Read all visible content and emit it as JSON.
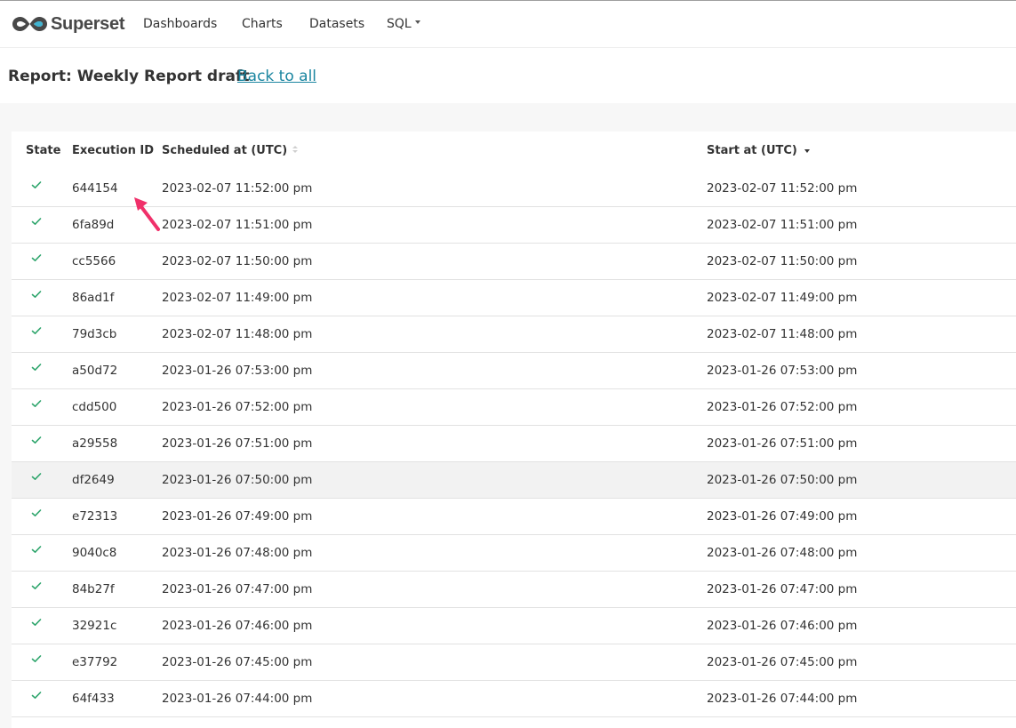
{
  "app": {
    "brand": "Superset",
    "nav": {
      "dashboards": "Dashboards",
      "charts": "Charts",
      "datasets": "Datasets",
      "sql": "SQL"
    }
  },
  "header": {
    "title": "Report: Weekly Report draft",
    "back_link": "Back to all"
  },
  "table": {
    "columns": {
      "state": "State",
      "execution_id": "Execution ID",
      "scheduled_at": "Scheduled at (UTC)",
      "start_at": "Start at (UTC)"
    },
    "sort": {
      "column": "start_at",
      "direction": "descending"
    },
    "status_color": "#2ea56c",
    "rows": [
      {
        "state": "success",
        "execution_id": "644154",
        "scheduled_at": "2023-02-07 11:52:00 pm",
        "start_at": "2023-02-07 11:52:00 pm"
      },
      {
        "state": "success",
        "execution_id": "6fa89d",
        "scheduled_at": "2023-02-07 11:51:00 pm",
        "start_at": "2023-02-07 11:51:00 pm"
      },
      {
        "state": "success",
        "execution_id": "cc5566",
        "scheduled_at": "2023-02-07 11:50:00 pm",
        "start_at": "2023-02-07 11:50:00 pm"
      },
      {
        "state": "success",
        "execution_id": "86ad1f",
        "scheduled_at": "2023-02-07 11:49:00 pm",
        "start_at": "2023-02-07 11:49:00 pm"
      },
      {
        "state": "success",
        "execution_id": "79d3cb",
        "scheduled_at": "2023-02-07 11:48:00 pm",
        "start_at": "2023-02-07 11:48:00 pm"
      },
      {
        "state": "success",
        "execution_id": "a50d72",
        "scheduled_at": "2023-01-26 07:53:00 pm",
        "start_at": "2023-01-26 07:53:00 pm"
      },
      {
        "state": "success",
        "execution_id": "cdd500",
        "scheduled_at": "2023-01-26 07:52:00 pm",
        "start_at": "2023-01-26 07:52:00 pm"
      },
      {
        "state": "success",
        "execution_id": "a29558",
        "scheduled_at": "2023-01-26 07:51:00 pm",
        "start_at": "2023-01-26 07:51:00 pm"
      },
      {
        "state": "success",
        "execution_id": "df2649",
        "scheduled_at": "2023-01-26 07:50:00 pm",
        "start_at": "2023-01-26 07:50:00 pm",
        "hover": true
      },
      {
        "state": "success",
        "execution_id": "e72313",
        "scheduled_at": "2023-01-26 07:49:00 pm",
        "start_at": "2023-01-26 07:49:00 pm"
      },
      {
        "state": "success",
        "execution_id": "9040c8",
        "scheduled_at": "2023-01-26 07:48:00 pm",
        "start_at": "2023-01-26 07:48:00 pm"
      },
      {
        "state": "success",
        "execution_id": "84b27f",
        "scheduled_at": "2023-01-26 07:47:00 pm",
        "start_at": "2023-01-26 07:47:00 pm"
      },
      {
        "state": "success",
        "execution_id": "32921c",
        "scheduled_at": "2023-01-26 07:46:00 pm",
        "start_at": "2023-01-26 07:46:00 pm"
      },
      {
        "state": "success",
        "execution_id": "e37792",
        "scheduled_at": "2023-01-26 07:45:00 pm",
        "start_at": "2023-01-26 07:45:00 pm"
      },
      {
        "state": "success",
        "execution_id": "64f433",
        "scheduled_at": "2023-01-26 07:44:00 pm",
        "start_at": "2023-01-26 07:44:00 pm"
      }
    ]
  },
  "annotation": {
    "arrow_color": "#f0306a"
  }
}
